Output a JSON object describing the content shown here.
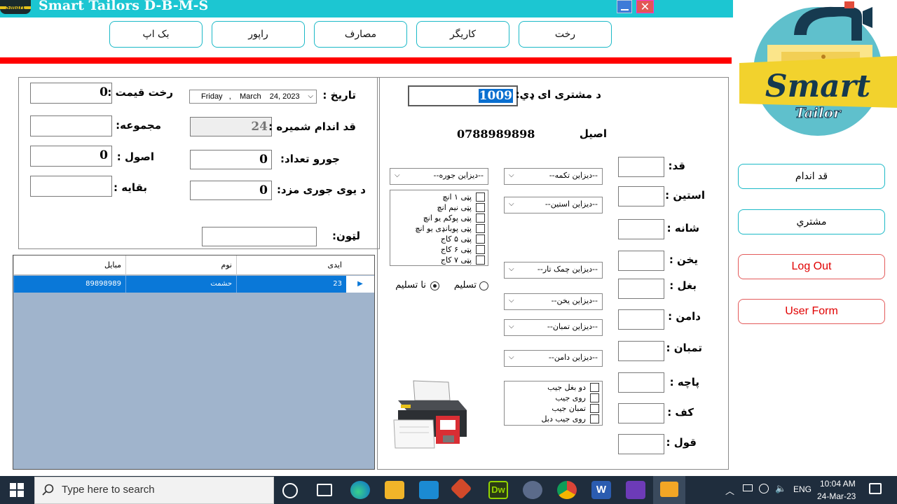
{
  "window": {
    "title": "Smart Tailors D-B-M-S",
    "logo_text": "Smart",
    "minimize_symbol": "",
    "close_symbol": "✕"
  },
  "nav": {
    "items": [
      {
        "label": "رخت"
      },
      {
        "label": "کاریگر"
      },
      {
        "label": "مصارف"
      },
      {
        "label": "راپور"
      },
      {
        "label": "بک اپ"
      }
    ]
  },
  "left_panel": {
    "price_label": "رخت قیمت :",
    "price_value": "0",
    "total_label": "مجموعه:",
    "total_value": "",
    "paid_label": "اصول :",
    "paid_value": "0",
    "remaining_label": "بقایه :",
    "remaining_value": "",
    "date_label": "تاریخ :",
    "date_value": "Friday   ,    March    24, 2023",
    "measure_no_label": "قد اندام شمیره :",
    "measure_no_value": "24",
    "pair_count_label": "جورو تعداد:",
    "pair_count_value": "0",
    "pair_wage_label": "د یوی جوری مزد:",
    "pair_wage_value": "0",
    "search_label": "لټون:",
    "search_value": ""
  },
  "grid": {
    "columns": [
      "ایدی",
      "نوم",
      "مبایل"
    ],
    "rows": [
      {
        "id": "23",
        "name": "حشمت",
        "mobile": "89898989"
      }
    ],
    "selector_symbol": "▶"
  },
  "right_panel": {
    "customer_id_label": "د مشتری ای ډي:",
    "customer_id_value": "1009",
    "name_value": "اصیل",
    "phone_value": "0788989898",
    "measurements": [
      {
        "label": "قد:",
        "value": ""
      },
      {
        "label": "استین :",
        "value": ""
      },
      {
        "label": "شانه :",
        "value": ""
      },
      {
        "label": "یخن :",
        "value": ""
      },
      {
        "label": "بغل :",
        "value": ""
      },
      {
        "label": "دامن :",
        "value": ""
      },
      {
        "label": "تمبان :",
        "value": ""
      },
      {
        "label": "پاچه :",
        "value": ""
      },
      {
        "label": "کف :",
        "value": ""
      },
      {
        "label": "قول :",
        "value": ""
      }
    ],
    "combos": {
      "button_design": "--دیزاین تکمه--",
      "pair_design": "--دیزاین جوره--",
      "sleeve_design": "--دیزاین استین--",
      "chamak_design": "--دیزاین چمک تار--",
      "collar_design": "--دیزاین یخن--",
      "trouser_design": "--دیزاین تمبان--",
      "hem_design": "--دیزاین دامن--"
    },
    "collar_options": [
      "پټی ۱ انچ",
      "پټی نیم انچ",
      "پټی پوکم یو انچ",
      "پټی پوبانډی یو انچ",
      "پټی ۵ کاج",
      "پټی ۶ کاج",
      "پټی ۷ کاج"
    ],
    "delivered_label": "تسلیم",
    "not_delivered_label": "نا تسلیم",
    "pocket_options": [
      "دو بغل جیب",
      "روی جیب",
      "تمبان جیب",
      "روی جیب دبل"
    ]
  },
  "sidebar": {
    "logo_title": "Smart",
    "logo_subtitle": "Tailor",
    "buttons": [
      {
        "label": "قد اندام"
      },
      {
        "label": "مشتري"
      },
      {
        "label": "Log Out"
      },
      {
        "label": "User Form"
      }
    ]
  },
  "taskbar": {
    "search_placeholder": "Type here to search",
    "language": "ENG",
    "time": "10:04 AM",
    "date": "24-Mar-23",
    "apps": [
      "cortana-icon",
      "task-view-icon",
      "edge-icon",
      "file-explorer-icon",
      "vscode-icon",
      "git-icon",
      "dreamweaver-icon",
      "photos-icon",
      "chrome-icon",
      "word-icon",
      "visual-studio-icon",
      "app-icon"
    ],
    "colors": {
      "accent": "#1cc6d2",
      "selection": "#0a78d8",
      "red_bar": "#ff0000"
    }
  }
}
